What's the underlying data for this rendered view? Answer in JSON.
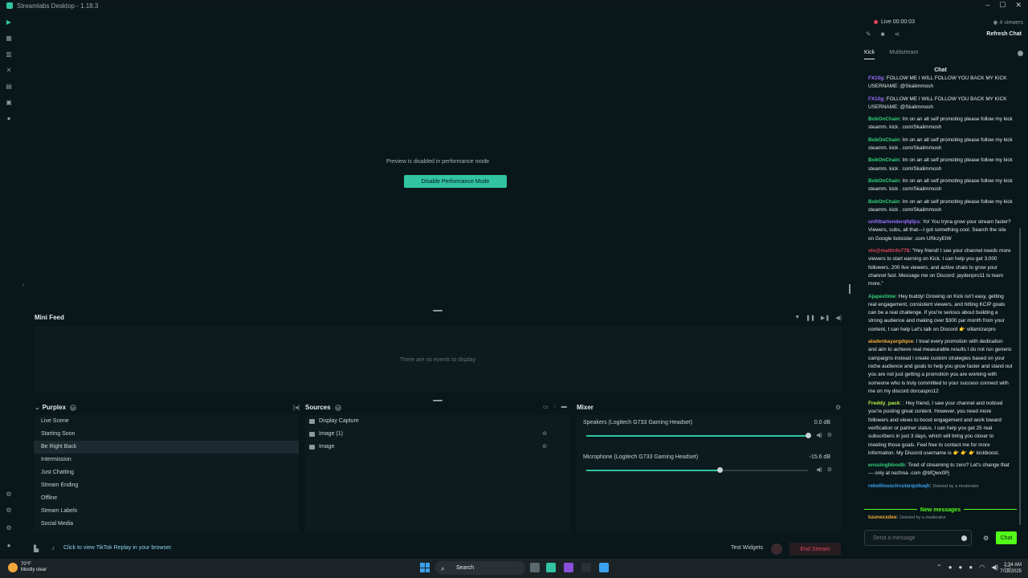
{
  "window": {
    "title": "Streamlabs Desktop - 1.18.3"
  },
  "preview": {
    "message": "Preview is disabled in performance mode",
    "button": "Disable Performance Mode"
  },
  "mini_feed": {
    "title": "Mini Feed",
    "empty": "There are no events to display"
  },
  "scenes": {
    "collection": "Purplex",
    "items": [
      "Live Scene",
      "Starting Soon",
      "Be Right Back",
      "Intermission",
      "Just Chatting",
      "Stream Ending",
      "Offline",
      "Stream Labels",
      "Social Media"
    ],
    "active": "Be Right Back"
  },
  "sources": {
    "title": "Sources",
    "items": [
      "Display Capture",
      "Image (1)",
      "Image"
    ]
  },
  "mixer": {
    "title": "Mixer",
    "channels": [
      {
        "name": "Speakers (Logitech G733 Gaming Headset)",
        "db": "0.0 dB",
        "level": 1.0
      },
      {
        "name": "Microphone (Logitech G733 Gaming Headset)",
        "db": "-15.6 dB",
        "level": 0.6
      }
    ]
  },
  "footer": {
    "tiktok": "Click to view TikTok Replay in your browser.",
    "test_widgets": "Test Widgets",
    "end_stream": "End Stream"
  },
  "chat": {
    "live": "Live 00:00:03",
    "viewers": "4 viewers",
    "refresh": "Refresh Chat",
    "tabs": [
      "Kick",
      "Multistream"
    ],
    "title": "Chat",
    "messages": [
      {
        "user": "FX10g",
        "color": "#9b6cff",
        "text": ": FOLLOW ME I WILL FOLLOW YOU BACK MY KICK USERNAME: @Skalimmosh"
      },
      {
        "user": "FX10g",
        "color": "#9b6cff",
        "text": ": FOLLOW ME I WILL FOLLOW YOU BACK MY KICK USERNAME: @Skalimmosh"
      },
      {
        "user": "BobOnChain",
        "color": "#33d17a",
        "text": ": Im on an alt self promoting please follow my kick steamm. kick . com/Skalimmosh"
      },
      {
        "user": "BobOnChain",
        "color": "#33d17a",
        "text": ": Im on an alt self promoting please follow my kick steamm. kick . com/Skalimmosh"
      },
      {
        "user": "BobOnChain",
        "color": "#33d17a",
        "text": ": Im on an alt self promoting please follow my kick steamm. kick . com/Skalimmosh"
      },
      {
        "user": "BobOnChain",
        "color": "#33d17a",
        "text": ": Im on an alt self promoting please follow my kick steamm. kick . com/Skalimmosh"
      },
      {
        "user": "BobOnChain",
        "color": "#33d17a",
        "text": ": Im on an alt self promoting please follow my kick steamm. kick . com/Skalimmosh"
      },
      {
        "user": "unfitbartenderqfq0ps",
        "color": "#9b6cff",
        "text": ": Yo! You tryna grow your stream faster? Viewers, subs, all that—I got something cool. Search the site on Google botsister .com URkzyEIW"
      },
      {
        "user": "vin@mattinfo778",
        "color": "#e0435b",
        "text": ": \"Hey friend! I see your channel needs more viewers to start earning on Kick. I can help you get 3,000 followers, 200 live viewers, and active chats to grow your channel fast. Message me on Discord: jaydenpro11 to learn more.\""
      },
      {
        "user": "Ajapextime",
        "color": "#33d17a",
        "text": ": Hey buddy! Growing on Kick isn't easy, getting real engagement, consistent viewers, and hitting KCIP goals can be a real challenge. If you're serious about building a strong audience and making over $300 par month from your content, I can help Let's talk on Discord 👉 villamizarpro"
      },
      {
        "user": "aladenkayargdqoe",
        "color": "#f2a93b",
        "text": ": I treat every promotion with dedication and aim to achieve real measurable results I do not run generic campaigns instead i create custom strategies based on your niche audience and goals to help you grow faster and stand out you are not just getting a promotion you are working with someone who is truly committed to your success connect with me on my discord dorcaspro12"
      },
      {
        "user": "Freddy_pack",
        "color": "#b5f04a",
        "text": ": : Hey friend, I saw your channel and noticed you're posting great content. However, you need more followers and views to boost engagement and work toward verification or partner status. I can help you get 25 real subscribers in just 3 days, which will bring you closer to meeting those goals. Feel free to contact me for more information. My Discord username is 👉 👉 👉 kickboost."
      },
      {
        "user": "ensuingbloodb",
        "color": "#33d17a",
        "text": ": Tired of streaming to zero? Let's change that — only at nezhna .com @bfQwx0Pj"
      },
      {
        "user": "rebelliousclrcularquituqh",
        "color": "#3aa2f0",
        "text": ":",
        "deleted": "Deleted by a moderator"
      }
    ],
    "new_messages": "New messages",
    "last": {
      "user": "tuunexxdee",
      "color": "#f2a93b",
      "deleted": "Deleted by a moderator"
    },
    "placeholder": "Send a message",
    "send": "Chat"
  },
  "taskbar": {
    "weather_temp": "70°F",
    "weather_desc": "Mostly clear",
    "search": "Search",
    "time": "2:34 AM",
    "date": "7/18/2025"
  }
}
